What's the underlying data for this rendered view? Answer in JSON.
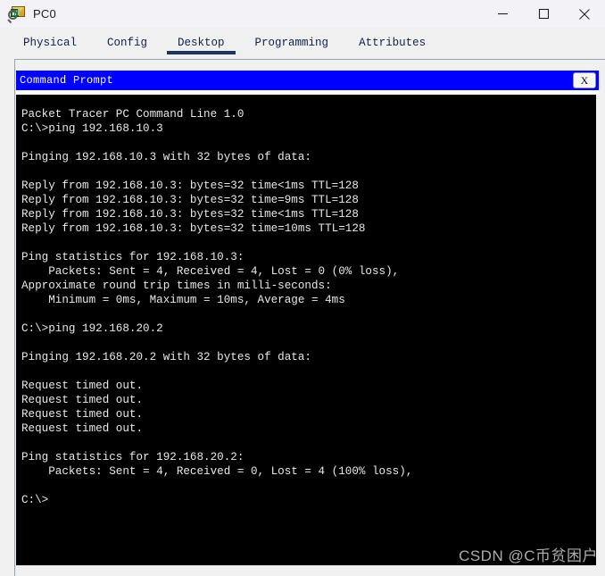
{
  "window": {
    "title": "PC0",
    "icon": "packet-tracer-pc-icon",
    "controls": {
      "minimize_label": "—",
      "maximize_label": "□",
      "close_label": "✕"
    }
  },
  "tabs": [
    {
      "label": "Physical",
      "active": false
    },
    {
      "label": "Config",
      "active": false
    },
    {
      "label": "Desktop",
      "active": true
    },
    {
      "label": "Programming",
      "active": false
    },
    {
      "label": "Attributes",
      "active": false
    }
  ],
  "command_prompt": {
    "title": "Command Prompt",
    "close_label": "X",
    "titlebar_color": "#0000ff",
    "background_color": "#000000",
    "text_color": "#e8e8e8",
    "lines": [
      "Packet Tracer PC Command Line 1.0",
      "C:\\>ping 192.168.10.3",
      "",
      "Pinging 192.168.10.3 with 32 bytes of data:",
      "",
      "Reply from 192.168.10.3: bytes=32 time<1ms TTL=128",
      "Reply from 192.168.10.3: bytes=32 time=9ms TTL=128",
      "Reply from 192.168.10.3: bytes=32 time<1ms TTL=128",
      "Reply from 192.168.10.3: bytes=32 time=10ms TTL=128",
      "",
      "Ping statistics for 192.168.10.3:",
      "    Packets: Sent = 4, Received = 4, Lost = 0 (0% loss),",
      "Approximate round trip times in milli-seconds:",
      "    Minimum = 0ms, Maximum = 10ms, Average = 4ms",
      "",
      "C:\\>ping 192.168.20.2",
      "",
      "Pinging 192.168.20.2 with 32 bytes of data:",
      "",
      "Request timed out.",
      "Request timed out.",
      "Request timed out.",
      "Request timed out.",
      "",
      "Ping statistics for 192.168.20.2:",
      "    Packets: Sent = 4, Received = 0, Lost = 4 (100% loss),",
      "",
      "C:\\>"
    ]
  },
  "watermark": {
    "text": "CSDN @C币贫困户"
  }
}
